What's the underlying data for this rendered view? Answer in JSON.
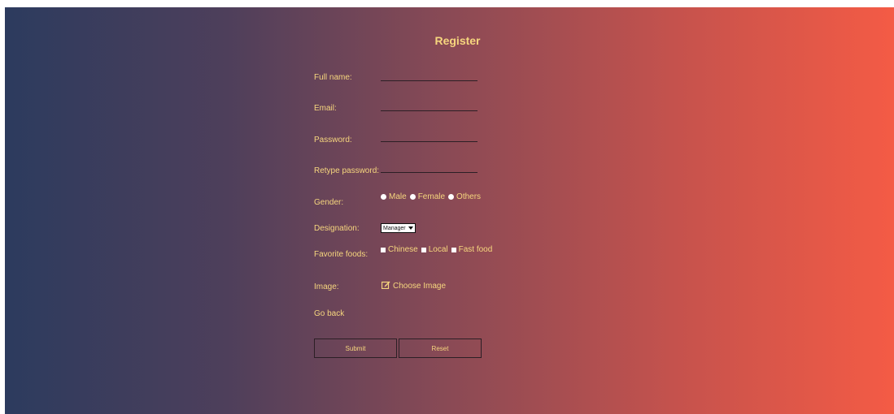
{
  "form": {
    "title": "Register",
    "fields": {
      "full_name": {
        "label": "Full name:",
        "value": ""
      },
      "email": {
        "label": "Email:",
        "value": ""
      },
      "password": {
        "label": "Password:",
        "value": ""
      },
      "retype_password": {
        "label": "Retype password:",
        "value": ""
      }
    },
    "gender": {
      "label": "Gender:",
      "options": [
        "Male",
        "Female",
        "Others"
      ]
    },
    "designation": {
      "label": "Designation:",
      "selected": "Manager"
    },
    "favorite_foods": {
      "label": "Favorite foods:",
      "options": [
        "Chinese",
        "Local",
        "Fast food"
      ]
    },
    "image": {
      "label": "Image:",
      "choose_label": "Choose Image"
    },
    "go_back": "Go back",
    "buttons": {
      "submit": "Submit",
      "reset": "Reset"
    }
  },
  "colors": {
    "gradient_start": "#2c3b5e",
    "gradient_end": "#f45b45",
    "label": "#f6d67e"
  },
  "icons": {
    "choose_image": "edit-icon",
    "select": "chevron-down-icon"
  }
}
